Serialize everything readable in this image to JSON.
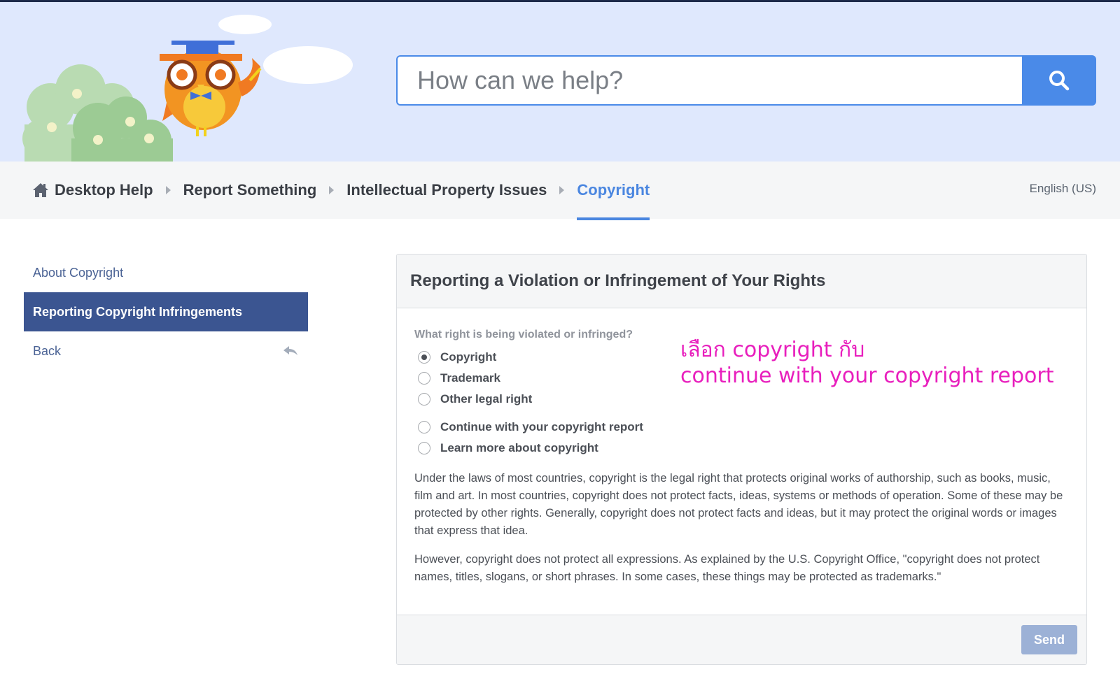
{
  "search": {
    "placeholder": "How can we help?"
  },
  "breadcrumb": {
    "items": [
      {
        "label": "Desktop Help"
      },
      {
        "label": "Report Something"
      },
      {
        "label": "Intellectual Property Issues"
      },
      {
        "label": "Copyright"
      }
    ]
  },
  "language": "English (US)",
  "sidebar": {
    "items": [
      {
        "label": "About Copyright"
      },
      {
        "label": "Reporting Copyright Infringements"
      },
      {
        "label": "Back"
      }
    ]
  },
  "form": {
    "title": "Reporting a Violation or Infringement of Your Rights",
    "question": "What right is being violated or infringed?",
    "rights": [
      {
        "label": "Copyright",
        "checked": true
      },
      {
        "label": "Trademark",
        "checked": false
      },
      {
        "label": "Other legal right",
        "checked": false
      }
    ],
    "next_steps": [
      {
        "label": "Continue with your copyright report",
        "checked": false
      },
      {
        "label": "Learn more about copyright",
        "checked": false
      }
    ],
    "paragraphs": [
      "Under the laws of most countries, copyright is the legal right that protects original works of authorship, such as books, music, film and art. In most countries, copyright does not protect facts, ideas, systems or methods of operation. Some of these may be protected by other rights. Generally, copyright does not protect facts and ideas, but it may protect the original words or images that express that idea.",
      "However, copyright does not protect all expressions. As explained by the U.S. Copyright Office, \"copyright does not protect names, titles, slogans, or short phrases. In some cases, these things may be protected as trademarks.\""
    ],
    "send_label": "Send"
  },
  "annotation": {
    "line1": "เลือก copyright กับ",
    "line2": "continue with your copyright report",
    "color": "#e81fbd"
  },
  "colors": {
    "accent": "#4a8ae8",
    "nav_active": "#3b5591",
    "hero_bg": "#dfe8fd"
  }
}
